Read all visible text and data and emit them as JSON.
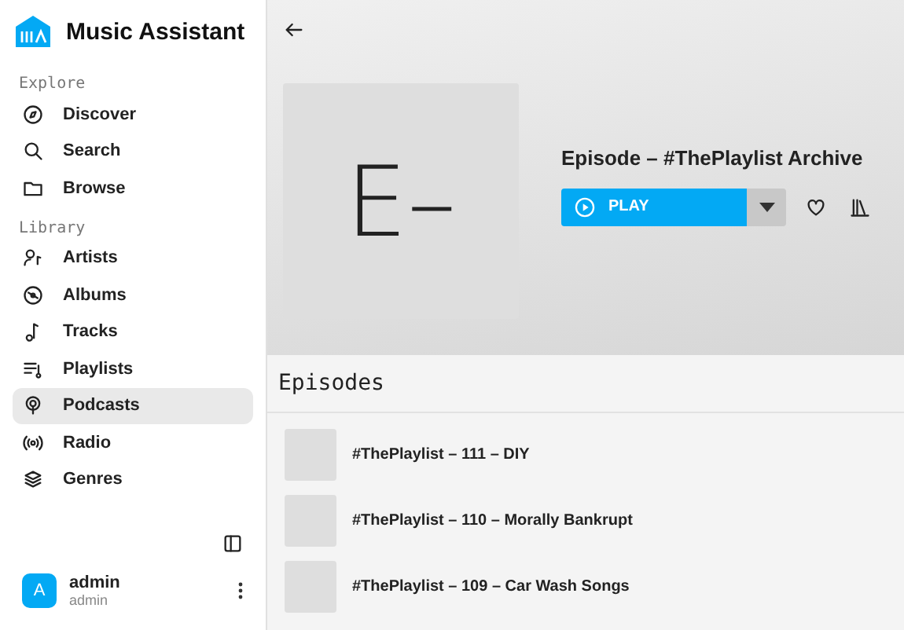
{
  "app": {
    "title": "Music Assistant"
  },
  "sidebar": {
    "sections": [
      {
        "heading": "Explore",
        "items": [
          {
            "label": "Discover",
            "selected": false
          },
          {
            "label": "Search",
            "selected": false
          },
          {
            "label": "Browse",
            "selected": false
          }
        ]
      },
      {
        "heading": "Library",
        "items": [
          {
            "label": "Artists",
            "selected": false
          },
          {
            "label": "Albums",
            "selected": false
          },
          {
            "label": "Tracks",
            "selected": false
          },
          {
            "label": "Playlists",
            "selected": false
          },
          {
            "label": "Podcasts",
            "selected": true
          },
          {
            "label": "Radio",
            "selected": false
          },
          {
            "label": "Genres",
            "selected": false
          }
        ]
      }
    ],
    "user": {
      "avatar": "A",
      "name": "admin",
      "role": "admin"
    }
  },
  "header": {
    "artwork_text": "E–",
    "title": "Episode – #ThePlaylist Archive",
    "play_button": "PLAY"
  },
  "episodes": {
    "heading": "Episodes",
    "rows": [
      {
        "title": "#ThePlaylist – 111 – DIY"
      },
      {
        "title": "#ThePlaylist – 110 – Morally Bankrupt"
      },
      {
        "title": "#ThePlaylist – 109 – Car Wash Songs"
      }
    ]
  }
}
